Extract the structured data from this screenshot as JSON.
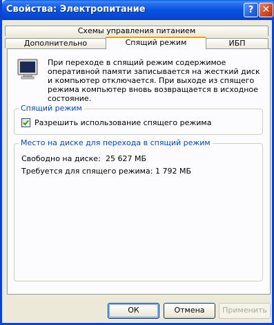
{
  "window": {
    "title": "Свойства: Электропитание",
    "help_glyph": "?",
    "close_glyph": "✕"
  },
  "tabs": {
    "back_row": [
      "Схемы управления питанием"
    ],
    "front_row": [
      "Дополнительно",
      "Спящий режим",
      "ИБП"
    ],
    "active": "Спящий режим"
  },
  "intro": {
    "icon": "hibernate-computer-icon",
    "text": "При переходе в спящий режим содержимое оперативной памяти записывается на жесткий диск и компьютер отключается. При выходе из спящего режима компьютер вновь возвращается в исходное состояние."
  },
  "hibernate_group": {
    "legend": "Спящий режим",
    "checkbox_label": "Разрешить использование спящего режима",
    "checked": true
  },
  "disk_group": {
    "legend": "Место на диске для перехода в спящий режим",
    "free_label": "Свободно на диске:",
    "free_value": "25 627 МБ",
    "required_label": "Требуется для спящего режима:",
    "required_value": "1 792 МБ"
  },
  "buttons": {
    "ok": "ОК",
    "cancel": "Отмена",
    "apply": "Применить"
  },
  "colors": {
    "title_bar": "#0853E0",
    "active_tab_accent": "#F0A000",
    "group_legend": "#0046D5",
    "dialog_bg": "#ECE9D8"
  }
}
